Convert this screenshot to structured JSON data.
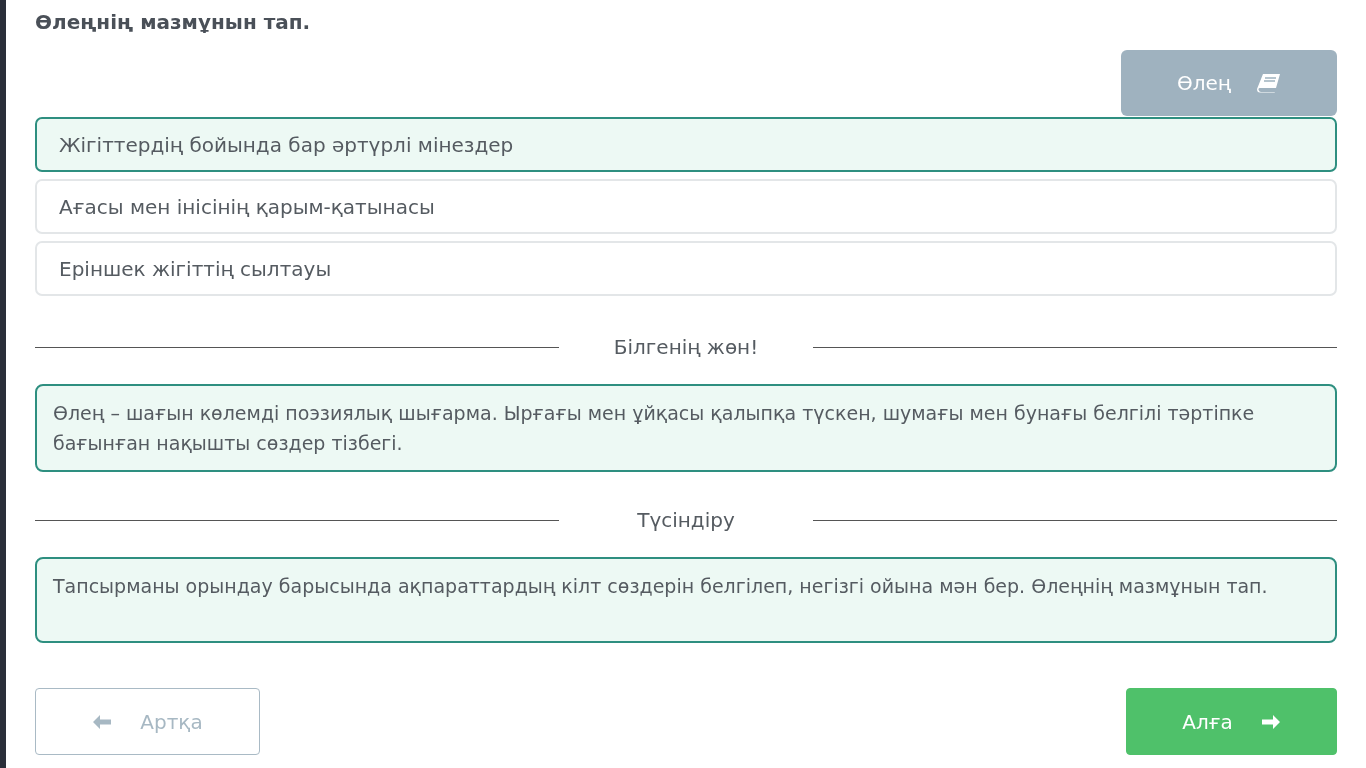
{
  "question": "Өлеңнің мазмұнын тап.",
  "poem_button": {
    "label": "Өлең"
  },
  "options": [
    {
      "text": "Жігіттердің бойында бар әртүрлі мінездер",
      "selected": true
    },
    {
      "text": "Ағасы мен інісінің қарым-қатынасы",
      "selected": false
    },
    {
      "text": "Еріншек жігіттің сылтауы",
      "selected": false
    }
  ],
  "sections": [
    {
      "heading": "Білгенің жөн!",
      "text": "Өлең – шағын көлемді поэзиялық шығарма. Ырғағы мен ұйқасы қалыпқа түскен, шумағы мен бунағы белгілі тәртіпке бағынған нақышты сөздер тізбегі."
    },
    {
      "heading": "Түсіндіру",
      "text": "Тапсырманы орындау барысында ақпараттардың кілт сөздерін белгілеп, негізгі ойына мән бер. Өлеңнің мазмұнын тап."
    }
  ],
  "navigation": [
    {
      "kind": "back",
      "label": "Артқа",
      "disabled": true
    },
    {
      "kind": "next",
      "label": "Алға",
      "disabled": false
    }
  ]
}
